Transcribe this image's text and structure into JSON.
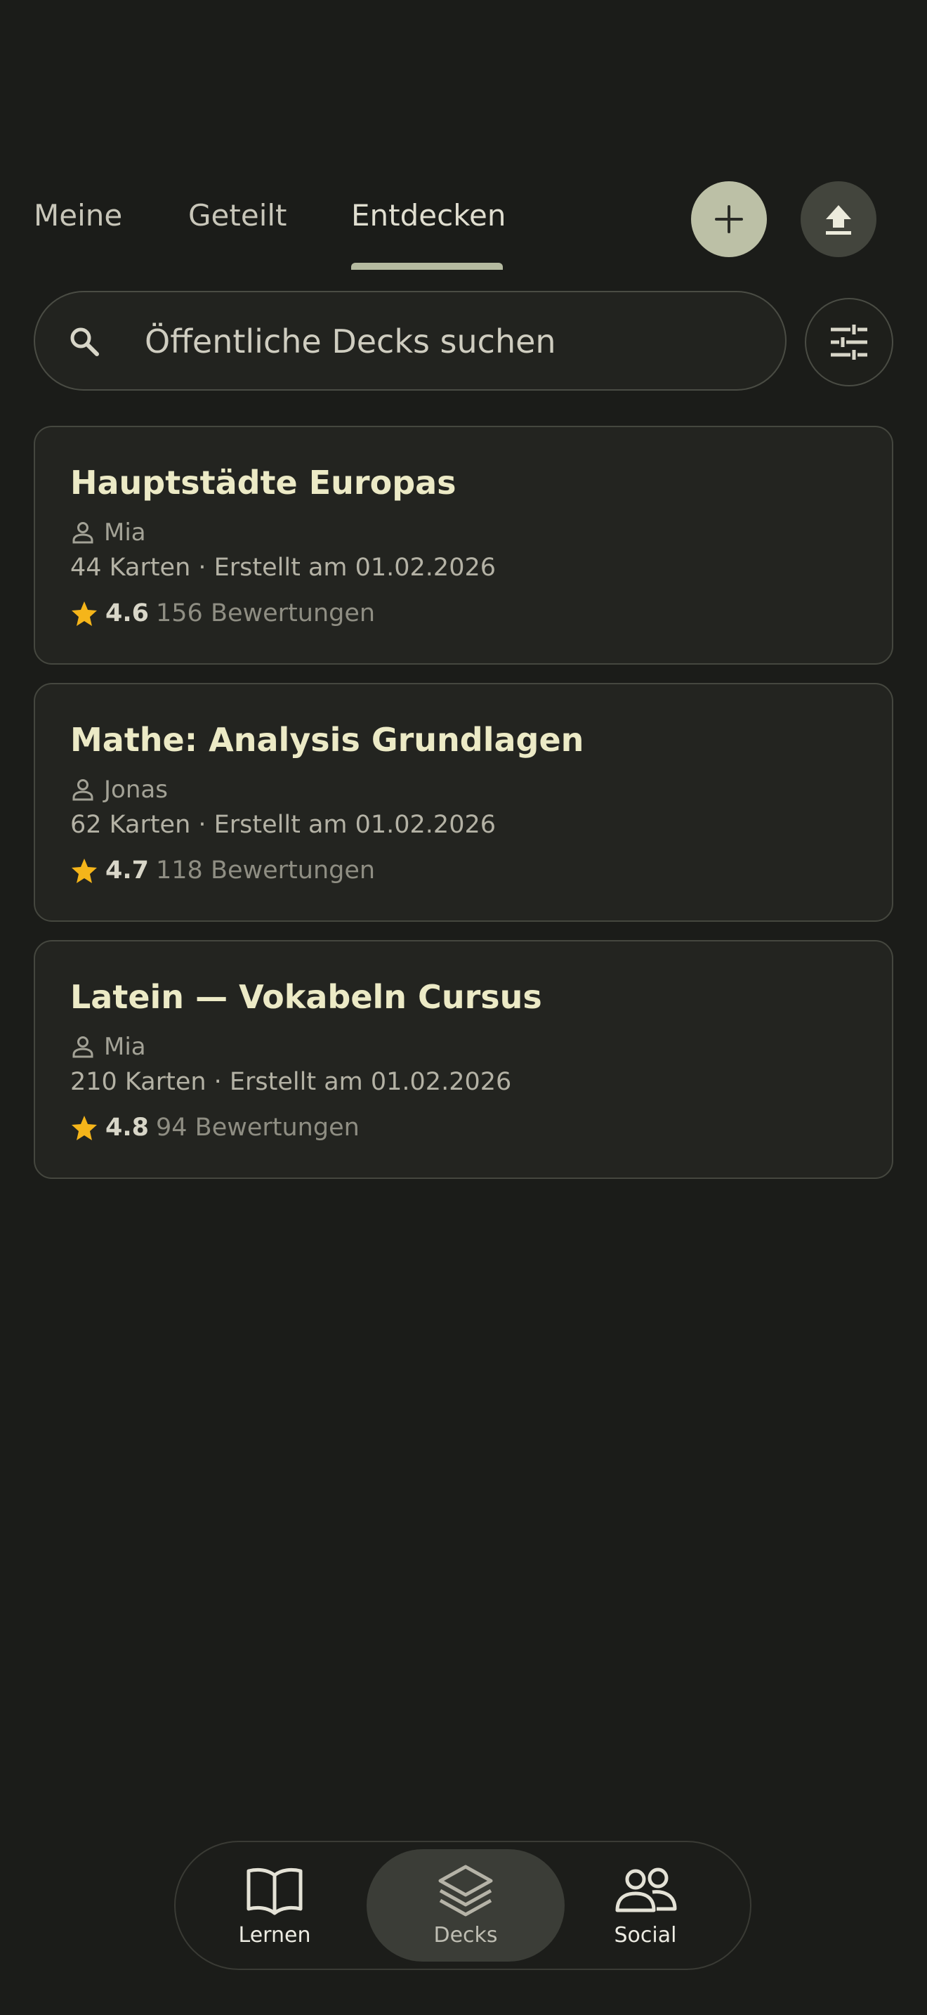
{
  "tabs": [
    {
      "label": "Meine",
      "active": false
    },
    {
      "label": "Geteilt",
      "active": false
    },
    {
      "label": "Entdecken",
      "active": true
    }
  ],
  "actions": {
    "add_icon": "plus-icon",
    "upload_icon": "upload-icon"
  },
  "search": {
    "placeholder": "Öffentliche Decks suchen",
    "value": "",
    "icon": "search-icon",
    "filter_icon": "tune-sliders-icon"
  },
  "decks": [
    {
      "title": "Hauptstädte Europas",
      "author": "Mia",
      "meta": "44 Karten · Erstellt am 01.02.2026",
      "rating": "4.6",
      "reviews": "156 Bewertungen"
    },
    {
      "title": "Mathe: Analysis Grundlagen",
      "author": "Jonas",
      "meta": "62 Karten · Erstellt am 01.02.2026",
      "rating": "4.7",
      "reviews": "118 Bewertungen"
    },
    {
      "title": "Latein — Vokabeln Cursus",
      "author": "Mia",
      "meta": "210 Karten · Erstellt am 01.02.2026",
      "rating": "4.8",
      "reviews": "94 Bewertungen"
    }
  ],
  "nav": [
    {
      "label": "Lernen",
      "icon": "book-icon",
      "active": false
    },
    {
      "label": "Decks",
      "icon": "layers-icon",
      "active": true
    },
    {
      "label": "Social",
      "icon": "people-icon",
      "active": false
    }
  ],
  "colors": {
    "background": "#1b1c19",
    "card": "#232420",
    "accent": "#bcc0a6",
    "star": "#f5b51a",
    "title": "#eceac6"
  }
}
